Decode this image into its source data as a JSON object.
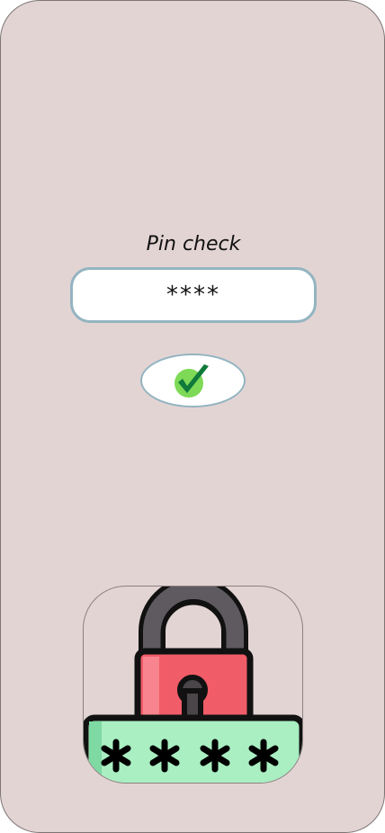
{
  "screen": {
    "title": "Pin check",
    "pin_value": "****"
  },
  "confirm_button": {
    "icon": "check-icon"
  },
  "illustration": {
    "icon": "padlock-password-icon",
    "password_text": "****"
  },
  "colors": {
    "background": "#e3d4d4",
    "field_border": "#93b4c0",
    "check_green": "#0f7a3a",
    "check_circle": "#7ed957",
    "lock_body": "#f05c68",
    "shackle": "#5f5a60",
    "password_bar": "#a9efc2"
  }
}
